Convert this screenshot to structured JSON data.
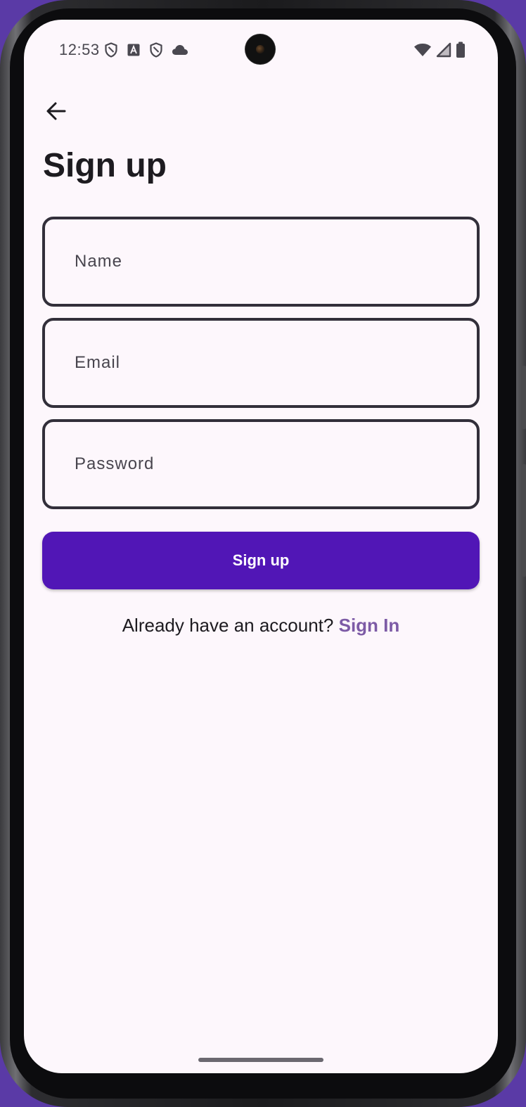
{
  "status_bar": {
    "time": "12:53",
    "left_icons": [
      "shield-icon",
      "a-badge-icon",
      "shield-icon",
      "cloud-icon"
    ],
    "right_icons": [
      "wifi-icon",
      "cellular-signal-icon",
      "battery-icon"
    ]
  },
  "header": {
    "back_icon": "arrow-back-icon",
    "title": "Sign up"
  },
  "form": {
    "name_placeholder": "Name",
    "email_placeholder": "Email",
    "password_placeholder": "Password",
    "submit_label": "Sign up"
  },
  "footer": {
    "prompt": "Already have an account?",
    "link_label": "Sign In"
  },
  "colors": {
    "background": "#fdf7fc",
    "primary": "#5116b6",
    "link": "#7d5ba6",
    "outline": "#322f3a"
  }
}
